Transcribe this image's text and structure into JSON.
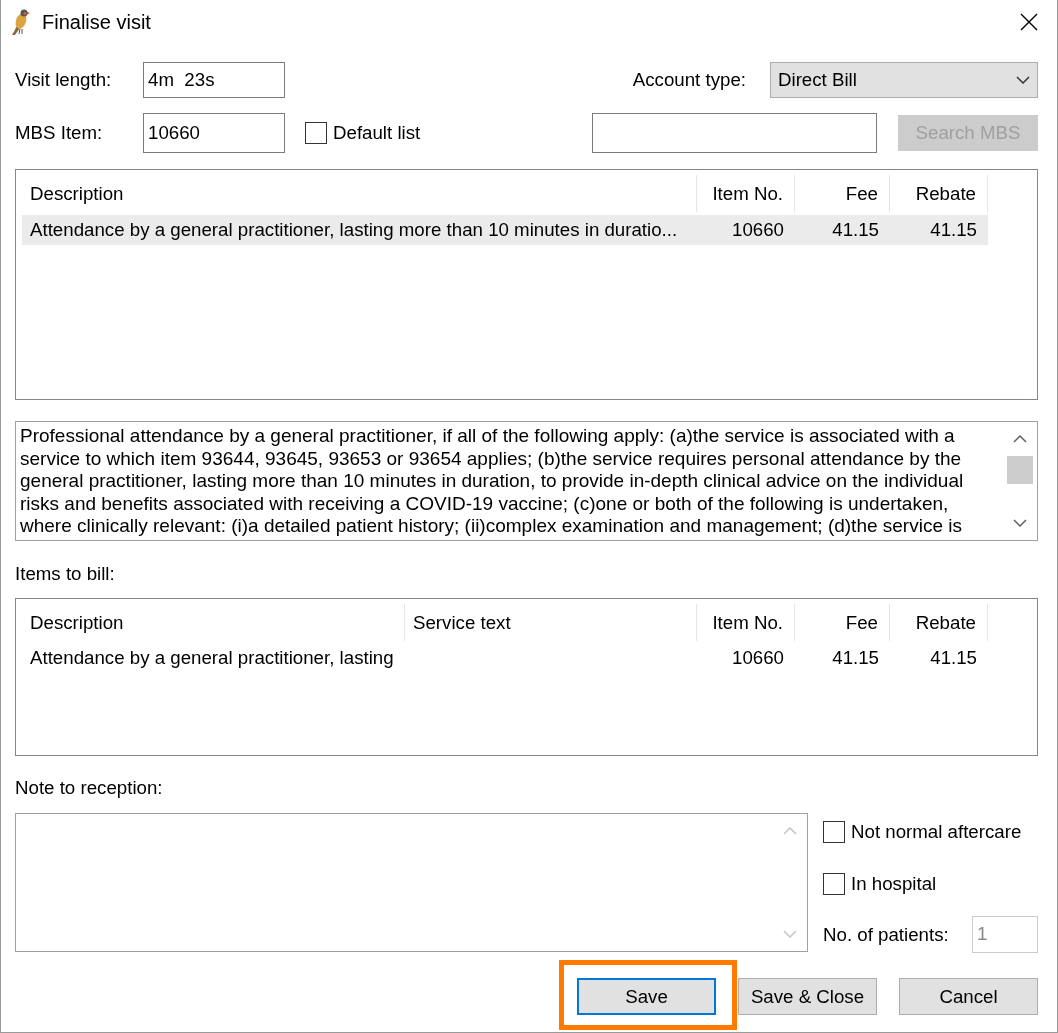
{
  "window": {
    "title": "Finalise visit"
  },
  "visit_length": {
    "label": "Visit length:",
    "value": "4m  23s"
  },
  "account_type": {
    "label": "Account type:",
    "value": "Direct Bill"
  },
  "mbs_item": {
    "label": "MBS Item:",
    "value": "10660"
  },
  "default_list": {
    "label": "Default list",
    "checked": false
  },
  "search_button": {
    "label": "Search MBS",
    "disabled": true
  },
  "mbs_table": {
    "columns": [
      "Description",
      "Item No.",
      "Fee",
      "Rebate"
    ],
    "rows": [
      {
        "description": "Attendance by a general practitioner, lasting more than 10 minutes in duratio...",
        "item_no": "10660",
        "fee": "41.15",
        "rebate": "41.15",
        "selected": true
      }
    ]
  },
  "item_description": "Professional attendance by a general practitioner, if all of the following apply: (a)the service is associated with a service to which item 93644, 93645, 93653 or 93654 applies; (b)the service requires personal attendance by the general practitioner, lasting more than 10 minutes in duration, to provide in-depth clinical advice on the individual risks and benefits associated with receiving a COVID-19 vaccine; (c)one or both of the following is undertaken, where clinically relevant: (i)a detailed patient history; (ii)complex examination and management; (d)the service is",
  "items_to_bill": {
    "label": "Items to bill:",
    "columns": [
      "Description",
      "Service text",
      "Item No.",
      "Fee",
      "Rebate"
    ],
    "rows": [
      {
        "description": "Attendance by a general practitioner, lasting",
        "item_no": "10660",
        "fee": "41.15",
        "rebate": "41.15",
        "selected": false
      }
    ]
  },
  "note_to_reception": {
    "label": "Note to reception:"
  },
  "options": [
    {
      "label": "Not normal aftercare",
      "checked": false
    },
    {
      "label": "In hospital",
      "checked": false
    }
  ],
  "patients": {
    "label": "No. of patients:",
    "value": "1",
    "disabled": true
  },
  "buttons": [
    {
      "label": "Save",
      "focused": true,
      "highlighted": true
    },
    {
      "label": "Save & Close",
      "focused": false,
      "highlighted": false
    },
    {
      "label": "Cancel",
      "focused": false,
      "highlighted": false
    }
  ]
}
